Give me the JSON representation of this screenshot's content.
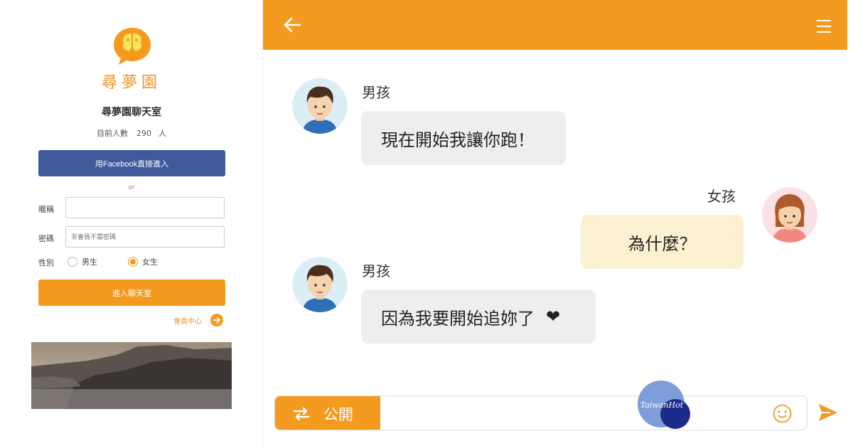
{
  "login": {
    "brand": "尋夢園",
    "room_title": "尋夢園聊天室",
    "count_label": "目前人數",
    "count_value": "290",
    "count_unit": "人",
    "facebook_label": "用Facebook直接進入",
    "or_label": "or",
    "nickname_label": "暱稱",
    "nickname_value": "",
    "password_label": "密碼",
    "password_placeholder": "非會員不需密碼",
    "gender_label": "性別",
    "gender_male": "男生",
    "gender_female": "女生",
    "gender_selected": "女生",
    "enter_label": "進入聊天室",
    "member_label": "會員中心"
  },
  "messages": [
    {
      "sender": "男孩",
      "text": "現在開始我讓你跑！",
      "side": "left"
    },
    {
      "sender": "女孩",
      "text": "為什麼？",
      "side": "right"
    },
    {
      "sender": "男孩",
      "text": "因為我要開始追妳了",
      "suffix": "❤",
      "side": "left"
    }
  ],
  "input_bar": {
    "mode_label": "公開",
    "message_value": ""
  },
  "watermark": {
    "text": "TaiwanHot"
  },
  "colors": {
    "accent": "#f39a1f",
    "facebook": "#40599b",
    "boy_bubble": "#eeeeee",
    "girl_bubble": "#fbf1d1"
  },
  "icons": {
    "back": "arrow-left-icon",
    "menu": "hamburger-icon",
    "swap": "swap-arrows-icon",
    "emoji": "smile-icon",
    "send": "send-icon",
    "member": "arrow-right-icon"
  }
}
